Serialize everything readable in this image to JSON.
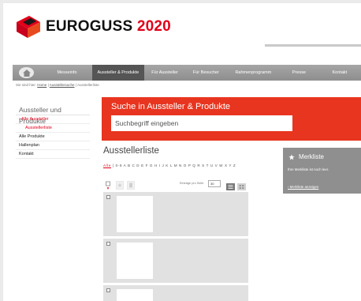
{
  "header": {
    "logo_text": "EUROGUSS",
    "logo_year": "2020"
  },
  "nav": {
    "items": [
      {
        "label": "Messeinfo"
      },
      {
        "label": "Aussteller & Produkte"
      },
      {
        "label": "Für Aussteller"
      },
      {
        "label": "Für Besucher"
      },
      {
        "label": "Rahmenprogramm"
      },
      {
        "label": "Presse"
      },
      {
        "label": "Kontakt"
      }
    ],
    "active_index": 1
  },
  "breadcrumb": {
    "prefix": "Sie sind hier:",
    "home": "Home",
    "sep": "|",
    "link2": "Ausstellersuche",
    "current": "Ausstellerliste"
  },
  "sidebar": {
    "title": "Aussteller und Produkte",
    "items": [
      {
        "label": "› Alle Aussteller"
      },
      {
        "label": "Ausstellerliste"
      },
      {
        "label": "Alle Produkte"
      },
      {
        "label": "Hallenplan"
      },
      {
        "label": "Kontakt"
      }
    ]
  },
  "search": {
    "title": "Suche in Aussteller & Produkte",
    "placeholder": "Suchbegriff eingeben"
  },
  "list": {
    "title": "Ausstellerliste",
    "alpha_all": "Alle",
    "alpha_rest": "| 0-9 A B C D E F G H I J K L M N O P Q R S T U V W X Y Z",
    "per_page_label": "Einträge pro Seite",
    "per_page_value": "30"
  },
  "merkliste": {
    "title": "Merkliste",
    "text": "Ihre Merkliste ist noch leer.",
    "link": "› Merkliste anzeigen"
  },
  "colors": {
    "brand_red": "#e2001a",
    "search_orange": "#e8351f",
    "nav_gray": "#9a9a9a",
    "merk_gray": "#8f8f8f"
  }
}
